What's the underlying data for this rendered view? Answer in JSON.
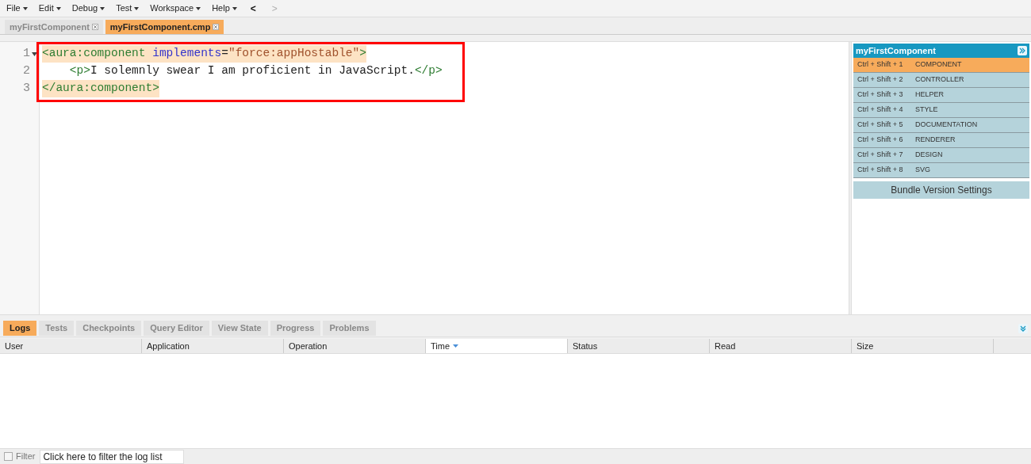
{
  "menu_bar": [
    {
      "kind": "menu",
      "label": "File"
    },
    {
      "kind": "menu",
      "label": "Edit"
    },
    {
      "kind": "menu",
      "label": "Debug"
    },
    {
      "kind": "menu",
      "label": "Test"
    },
    {
      "kind": "menu",
      "label": "Workspace"
    },
    {
      "kind": "menu",
      "label": "Help"
    },
    {
      "kind": "nav",
      "label": "<",
      "disabled": false
    },
    {
      "kind": "nav",
      "label": ">",
      "disabled": true
    }
  ],
  "editor_tabs": [
    {
      "label": "myFirstComponent",
      "selected": false
    },
    {
      "label": "myFirstComponent.cmp",
      "selected": true
    }
  ],
  "editor": {
    "lines": [
      {
        "number": "1",
        "foldable": true,
        "highlighted": true,
        "indented": false,
        "tokens": [
          {
            "kind": "tag",
            "text": "<aura:component"
          },
          {
            "kind": "attr",
            "text": "implements",
            "space_before": true
          },
          {
            "kind": "text",
            "text": "="
          },
          {
            "kind": "string",
            "text": "\"force:appHostable\""
          },
          {
            "kind": "tag",
            "text": ">"
          }
        ]
      },
      {
        "number": "2",
        "foldable": false,
        "highlighted": false,
        "indented": true,
        "tokens": [
          {
            "kind": "tag",
            "text": "<p>"
          },
          {
            "kind": "text",
            "text": "I solemnly swear I am proficient in JavaScript."
          },
          {
            "kind": "tag",
            "text": "</p>"
          }
        ]
      },
      {
        "number": "3",
        "foldable": false,
        "highlighted": true,
        "indented": false,
        "tokens": [
          {
            "kind": "tag",
            "text": "</aura:component>"
          }
        ]
      }
    ]
  },
  "bundle_panel": {
    "title": "myFirstComponent",
    "items": [
      {
        "shortcut": "Ctrl + Shift + 1",
        "label": "COMPONENT",
        "selected": true
      },
      {
        "shortcut": "Ctrl + Shift + 2",
        "label": "CONTROLLER",
        "selected": false
      },
      {
        "shortcut": "Ctrl + Shift + 3",
        "label": "HELPER",
        "selected": false
      },
      {
        "shortcut": "Ctrl + Shift + 4",
        "label": "STYLE",
        "selected": false
      },
      {
        "shortcut": "Ctrl + Shift + 5",
        "label": "DOCUMENTATION",
        "selected": false
      },
      {
        "shortcut": "Ctrl + Shift + 6",
        "label": "RENDERER",
        "selected": false
      },
      {
        "shortcut": "Ctrl + Shift + 7",
        "label": "DESIGN",
        "selected": false
      },
      {
        "shortcut": "Ctrl + Shift + 8",
        "label": "SVG",
        "selected": false
      }
    ],
    "settings_button": "Bundle Version Settings"
  },
  "bottom_tabs": [
    {
      "label": "Logs",
      "selected": true
    },
    {
      "label": "Tests",
      "selected": false
    },
    {
      "label": "Checkpoints",
      "selected": false
    },
    {
      "label": "Query Editor",
      "selected": false
    },
    {
      "label": "View State",
      "selected": false
    },
    {
      "label": "Progress",
      "selected": false
    },
    {
      "label": "Problems",
      "selected": false
    }
  ],
  "log_table": {
    "columns": [
      {
        "label": "User",
        "sorted": false
      },
      {
        "label": "Application",
        "sorted": false
      },
      {
        "label": "Operation",
        "sorted": false
      },
      {
        "label": "Time",
        "sorted": true
      },
      {
        "label": "Status",
        "sorted": false
      },
      {
        "label": "Read",
        "sorted": false
      },
      {
        "label": "Size",
        "sorted": false
      }
    ]
  },
  "filter": {
    "label": "Filter",
    "checked": false,
    "placeholder": "Click here to filter the log list"
  }
}
